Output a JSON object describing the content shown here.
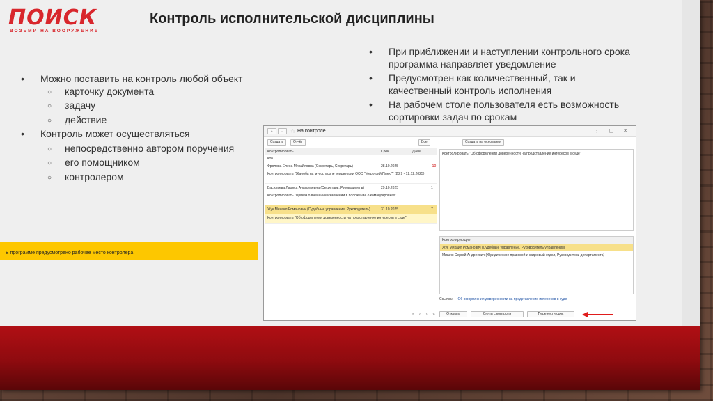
{
  "logo": {
    "word": "ПОИСК",
    "tagline": "ВОЗЬМИ НА ВООРУЖЕНИЕ"
  },
  "title": "Контроль исполнительской дисциплины",
  "left_bullets": [
    {
      "text": "Можно поставить на контроль любой объект",
      "level": 1
    },
    {
      "text": "карточку документа",
      "level": 2
    },
    {
      "text": "задачу",
      "level": 2
    },
    {
      "text": "действие",
      "level": 2
    },
    {
      "text": "Контроль может осуществляться",
      "level": 1
    },
    {
      "text": "непосредственно автором поручения",
      "level": 2
    },
    {
      "text": "его помощником",
      "level": 2
    },
    {
      "text": "контролером",
      "level": 2
    }
  ],
  "right_bullets": [
    "При приближении и наступлении контрольного срока программа направляет уведомление",
    "Предусмотрен как количественный, так и качественный контроль исполнения",
    "На рабочем столе пользователя есть возможность сортировки задач по срокам"
  ],
  "yellow_note": "В программе предусмотрено рабочее место контролера",
  "window": {
    "title": "На контроле",
    "toolbar": {
      "create": "Создать",
      "report": "Отчёт",
      "all": "Все",
      "search": "Создать на основании"
    },
    "columns": {
      "control": "Контролировать",
      "date": "Срок",
      "days": "Дней"
    },
    "group_label": "Кто",
    "rows": [
      {
        "author": "Фролова Елена Михайловна (Секретарь, Секретарь)",
        "date": "28.10.2025",
        "days": "-10",
        "subject": "Контролировать \"Жалоба на мусор возле территории ООО \"Меркурий Плюс\"\" (28.9 - 12.12.2025)"
      },
      {
        "author": "Васильева Лариса Анатольевна (Секретарь, Руководитель)",
        "date": "29.10.2025",
        "days": "1",
        "subject": "Контролировать \"Приказ о внесении изменений в положение о командировках\""
      },
      {
        "author": "Жук Михаил Романович (Судебные управление, Руководитель)",
        "date": "31.10.2025",
        "days": "7",
        "subject": "Контролировать \"Об оформлении доверенности на представление интересов в суде\""
      }
    ],
    "detail_text": "Контролировать \"Об оформлении доверенности на представление интересов в суде\"",
    "controllers_label": "Контролирующие",
    "controllers": [
      "Жук Михаил Романович (Судебные управление, Руководитель управления)",
      "Мишин Сергей Андреевич (Юридическое правовой и кадровый отдел, Руководитель департамента)"
    ],
    "reference_label": "Ссылка:",
    "reference_value": "Об оформлении доверенности на представление интересов в суде",
    "buttons": {
      "open": "Открыть",
      "remove": "Снять с контроля",
      "postpone": "Перенести срок"
    },
    "pager": "« ‹ › »"
  },
  "colors": {
    "accent_red": "#d8262c",
    "highlight": "#fdc700",
    "band_red": "#b10f14"
  }
}
